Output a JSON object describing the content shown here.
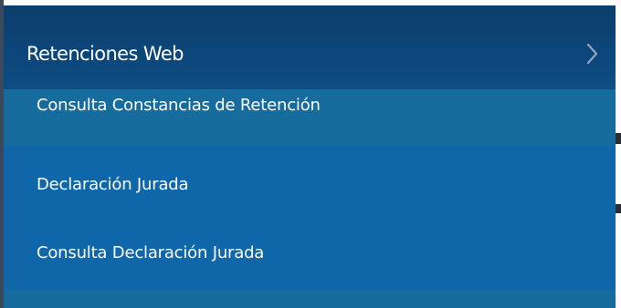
{
  "menu": {
    "header": {
      "label": "Retenciones Web",
      "icon": "chevron-right-icon"
    },
    "items": [
      {
        "label": "Consulta Constancias de Retención"
      },
      {
        "label": "Declaración Jurada"
      },
      {
        "label": "Consulta Declaración Jurada"
      }
    ]
  },
  "colors": {
    "header_bg": "#0c467a",
    "item_highlight_bg": "#176c9e",
    "item_bg": "#0f66a8",
    "text": "#ffffff"
  }
}
